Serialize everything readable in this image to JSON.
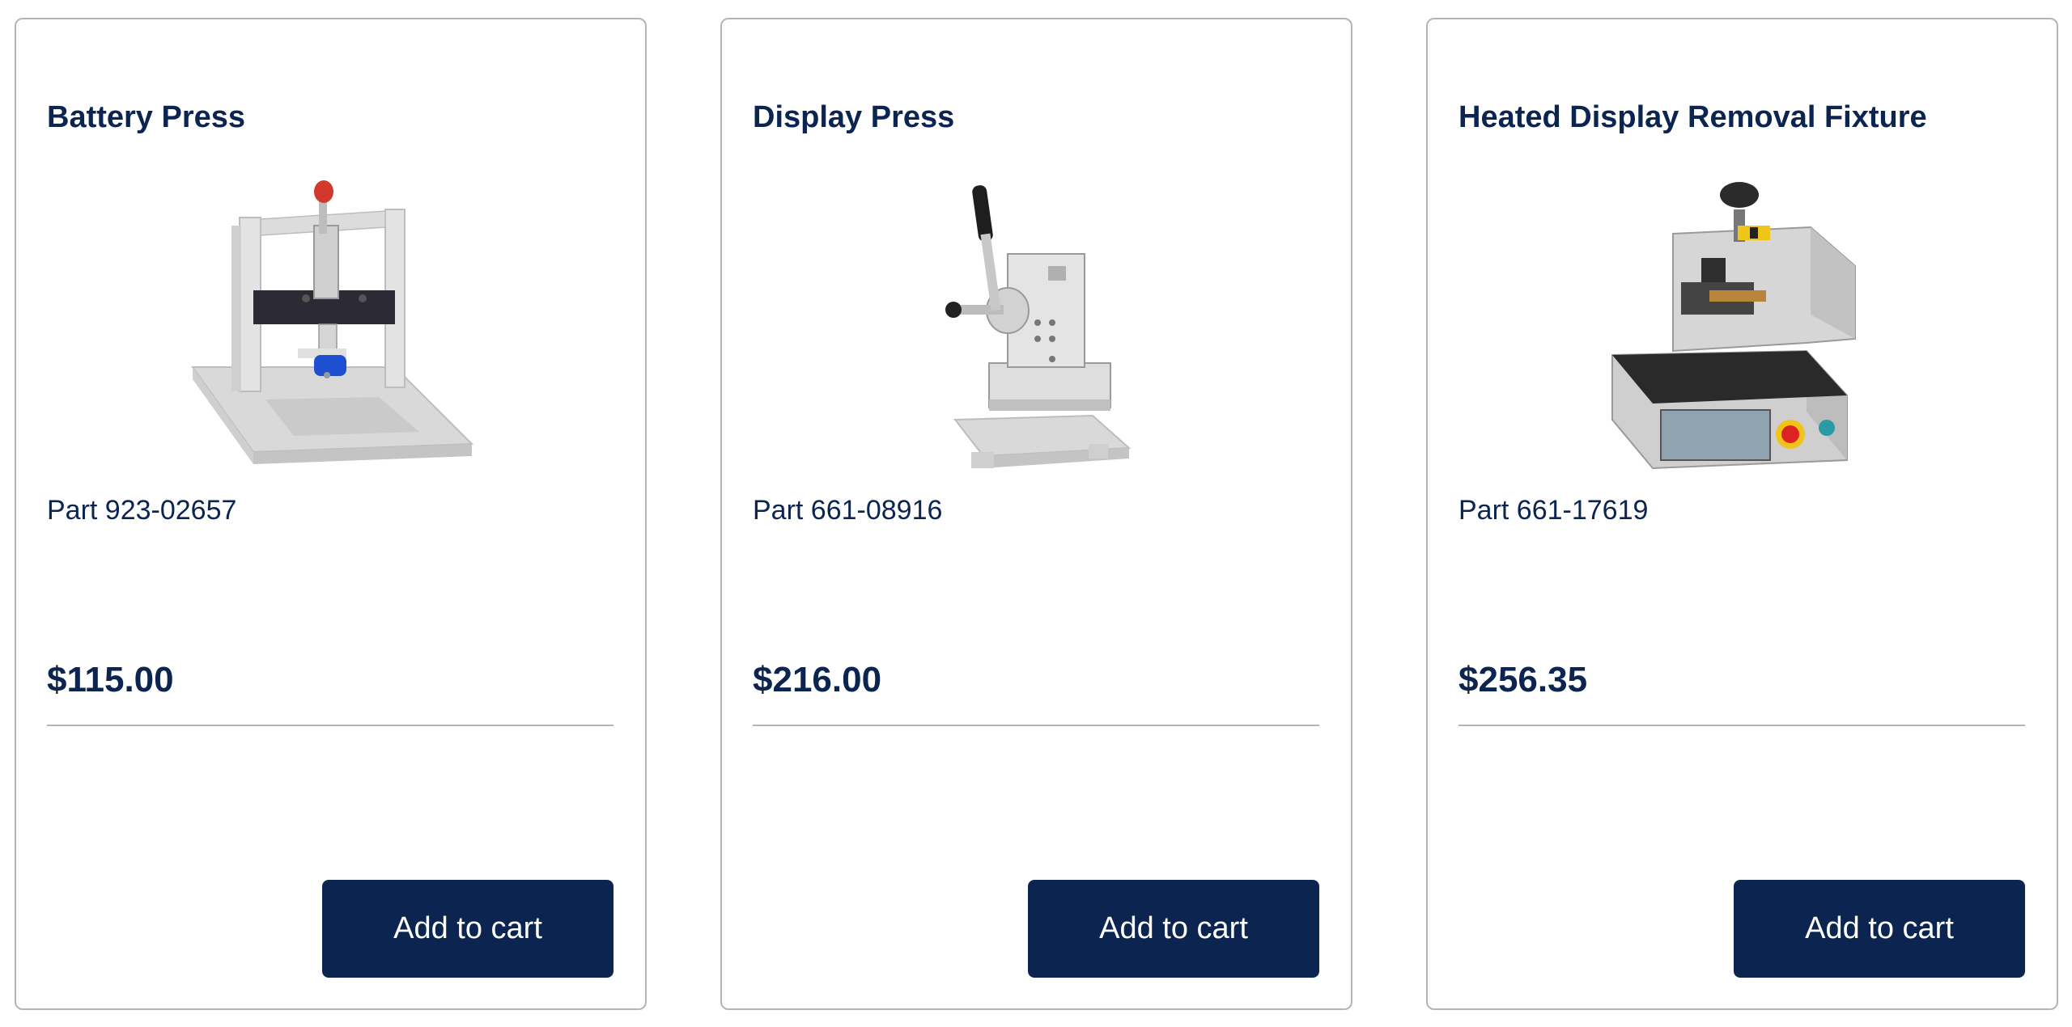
{
  "products": [
    {
      "title": "Battery Press",
      "image_icon": "battery-press-image",
      "part": "Part 923-02657",
      "price": "$115.00",
      "button_label": "Add to cart"
    },
    {
      "title": "Display Press",
      "image_icon": "display-press-image",
      "part": "Part 661-08916",
      "price": "$216.00",
      "button_label": "Add to cart"
    },
    {
      "title": "Heated Display Removal Fixture",
      "image_icon": "heated-display-removal-fixture-image",
      "part": "Part 661-17619",
      "price": "$256.35",
      "button_label": "Add to cart"
    }
  ],
  "colors": {
    "brand_navy": "#0b2550",
    "card_border": "#b4b4b4",
    "button_text": "#ffffff"
  }
}
